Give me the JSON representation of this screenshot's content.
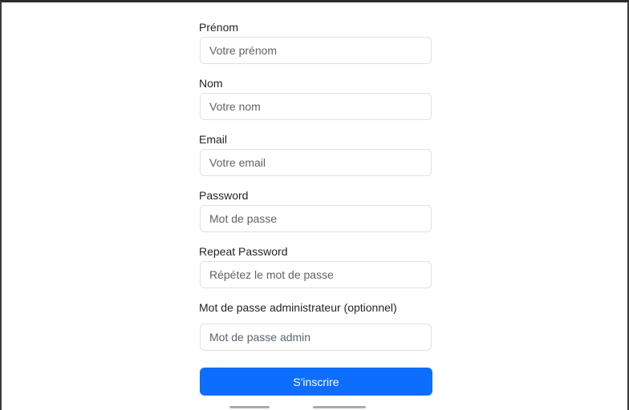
{
  "form": {
    "fields": [
      {
        "label": "Prénom",
        "placeholder": "Votre prénom",
        "value": ""
      },
      {
        "label": "Nom",
        "placeholder": "Votre nom",
        "value": ""
      },
      {
        "label": "Email",
        "placeholder": "Votre email",
        "value": ""
      },
      {
        "label": "Password",
        "placeholder": "Mot de passe",
        "value": ""
      },
      {
        "label": "Repeat Password",
        "placeholder": "Répétez le mot de passe",
        "value": ""
      },
      {
        "label": "Mot de passe administrateur (optionnel)",
        "placeholder": "Mot de passe admin",
        "value": ""
      }
    ],
    "submit_label": "S'inscrire"
  },
  "colors": {
    "primary": "#0d6efd",
    "input_border": "#dee2e6",
    "label_text": "#212529",
    "placeholder_text": "#5c636a"
  }
}
